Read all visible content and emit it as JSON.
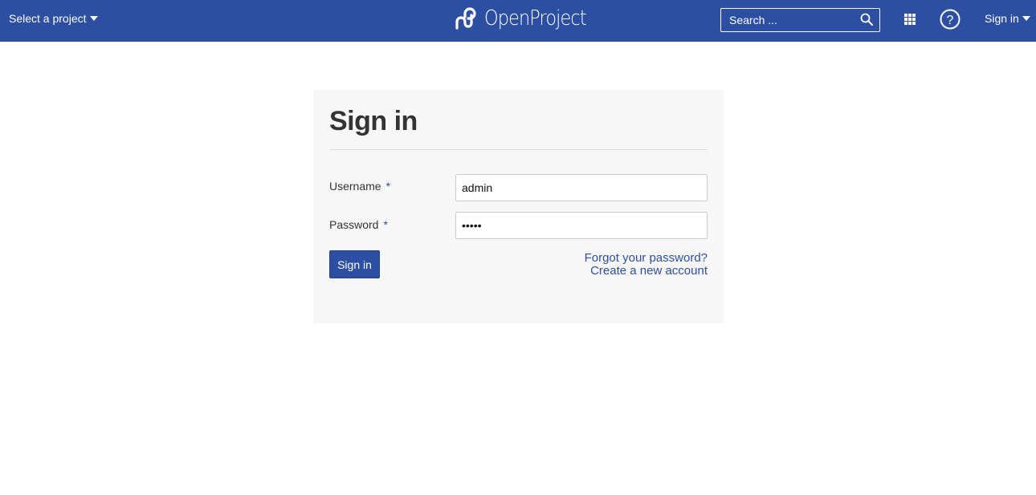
{
  "header": {
    "project_select_label": "Select a project",
    "logo_text": "OpenProject",
    "search_placeholder": "Search ...",
    "signin_menu_label": "Sign in",
    "brand_color": "#2c4fa2"
  },
  "login": {
    "title": "Sign in",
    "username_label": "Username",
    "username_value": "admin",
    "password_label": "Password",
    "password_value": "admin",
    "required_marker": "*",
    "submit_label": "Sign in",
    "forgot_password_link": "Forgot your password?",
    "create_account_link": "Create a new account"
  }
}
